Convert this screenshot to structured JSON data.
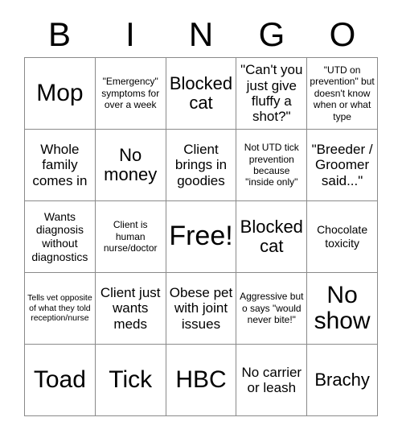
{
  "card": {
    "title": "BINGO",
    "header_letters": [
      "B",
      "I",
      "N",
      "G",
      "O"
    ],
    "colors": {
      "background": "#ffffff",
      "text": "#000000",
      "grid_line": "#8a8a8a"
    },
    "grid": {
      "columns": 5,
      "rows": 5,
      "free_space_index": 12
    },
    "cells": [
      {
        "text": "Mop",
        "size": "xl"
      },
      {
        "text": "\"Emergency\" symptoms for over a week",
        "size": "xs"
      },
      {
        "text": "Blocked cat",
        "size": "lg"
      },
      {
        "text": "\"Can't you just give fluffy a shot?\"",
        "size": "md"
      },
      {
        "text": "\"UTD on prevention\" but doesn't know when or what type",
        "size": "xs"
      },
      {
        "text": "Whole family comes in",
        "size": "md"
      },
      {
        "text": "No money",
        "size": "lg"
      },
      {
        "text": "Client brings in goodies",
        "size": "md"
      },
      {
        "text": "Not UTD tick prevention because \"inside only\"",
        "size": "xs"
      },
      {
        "text": "\"Breeder / Groomer said...\"",
        "size": "md"
      },
      {
        "text": "Wants diagnosis without diagnostics",
        "size": "sm"
      },
      {
        "text": "Client is human nurse/doctor",
        "size": "xs"
      },
      {
        "text": "Free!",
        "size": "xxl"
      },
      {
        "text": "Blocked cat",
        "size": "lg"
      },
      {
        "text": "Chocolate toxicity",
        "size": "sm"
      },
      {
        "text": "Tells vet opposite of what they told reception/nurse",
        "size": "xxs"
      },
      {
        "text": "Client just wants meds",
        "size": "md"
      },
      {
        "text": "Obese pet with joint issues",
        "size": "md"
      },
      {
        "text": "Aggressive but o says \"would never bite!\"",
        "size": "xs"
      },
      {
        "text": "No show",
        "size": "xl"
      },
      {
        "text": "Toad",
        "size": "xl"
      },
      {
        "text": "Tick",
        "size": "xl"
      },
      {
        "text": "HBC",
        "size": "xl"
      },
      {
        "text": "No carrier or leash",
        "size": "md"
      },
      {
        "text": "Brachy",
        "size": "lg"
      }
    ]
  }
}
